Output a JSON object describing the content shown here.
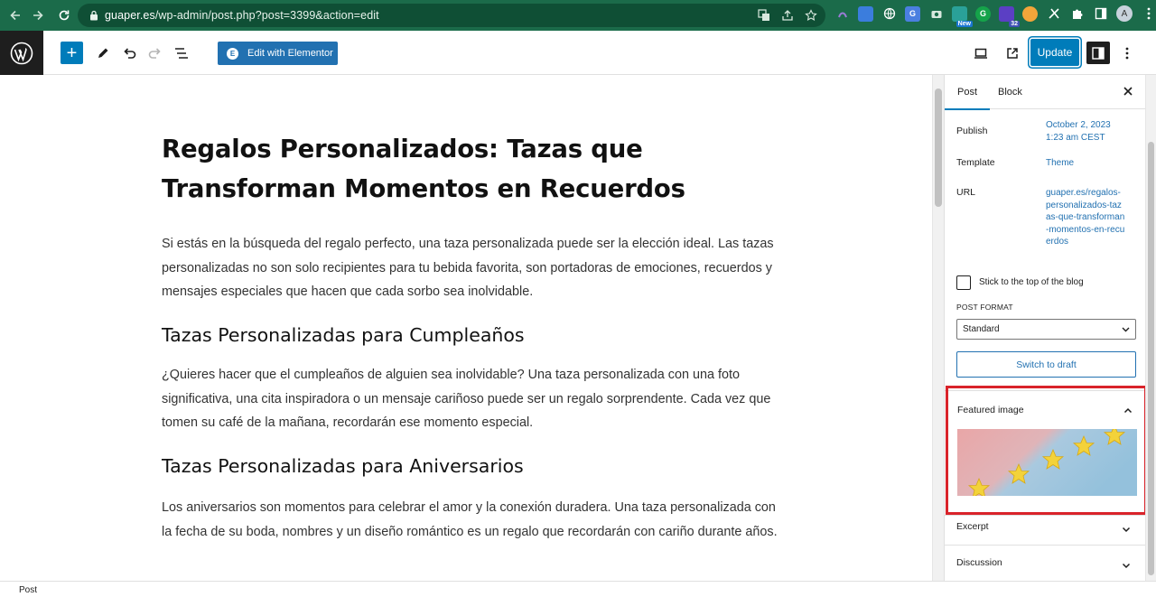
{
  "browser": {
    "url_domain": "guaper.es",
    "url_path": "/wp-admin/post.php?post=3399&action=edit",
    "extension_badge_count": "32",
    "extension_badge_new": "New",
    "profile_initial": "A"
  },
  "toolbar": {
    "elementor_label": "Edit with Elementor",
    "update_label": "Update"
  },
  "post": {
    "title": "Regalos Personalizados: Tazas que Transforman Momentos en Recuerdos",
    "paragraph1": "Si estás en la búsqueda del regalo perfecto, una taza personalizada puede ser la elección ideal. Las tazas personalizadas no son solo recipientes para tu bebida favorita, son portadoras de emociones, recuerdos y mensajes especiales que hacen que cada sorbo sea inolvidable.",
    "heading1": "Tazas Personalizadas para Cumpleaños",
    "paragraph2": "¿Quieres hacer que el cumpleaños de alguien sea inolvidable? Una taza personalizada con una foto significativa, una cita inspiradora o un mensaje cariñoso puede ser un regalo sorprendente. Cada vez que tomen su café de la mañana, recordarán ese momento especial.",
    "heading2": "Tazas Personalizadas para Aniversarios",
    "paragraph3": "Los aniversarios son momentos para celebrar el amor y la conexión duradera. Una taza personalizada con la fecha de su boda, nombres y un diseño romántico es un regalo que recordarán con cariño durante años."
  },
  "sidebar": {
    "tab_post": "Post",
    "tab_block": "Block",
    "publish_label": "Publish",
    "publish_value": "October 2, 2023 1:23 am CEST",
    "template_label": "Template",
    "template_value": "Theme",
    "url_label": "URL",
    "url_value": "guaper.es/regalos-personalizados-tazas-que-transforman-momentos-en-recuerdos",
    "sticky_label": "Stick to the top of the blog",
    "post_format_label": "POST FORMAT",
    "post_format_value": "Standard",
    "switch_draft_label": "Switch to draft",
    "featured_image_label": "Featured image",
    "excerpt_label": "Excerpt",
    "discussion_label": "Discussion"
  },
  "footer": {
    "breadcrumb": "Post"
  },
  "colors": {
    "accent": "#007cba",
    "browser_bar": "#1b6b4a",
    "highlight": "#d9232a"
  }
}
